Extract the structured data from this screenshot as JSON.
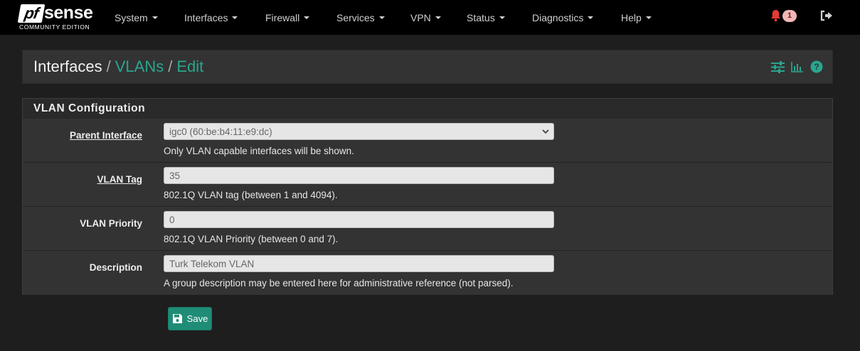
{
  "brand": {
    "logo_pf": "pf",
    "logo_sense": "sense",
    "edition": "COMMUNITY EDITION"
  },
  "nav": {
    "items": [
      {
        "label": "System"
      },
      {
        "label": "Interfaces"
      },
      {
        "label": "Firewall"
      },
      {
        "label": "Services"
      },
      {
        "label": "VPN"
      },
      {
        "label": "Status"
      },
      {
        "label": "Diagnostics"
      },
      {
        "label": "Help"
      }
    ],
    "alert_count": "1",
    "icons": {
      "alert": "bell-icon",
      "logout": "sign-out-icon"
    }
  },
  "breadcrumb": {
    "root": "Interfaces",
    "sep1": "/",
    "level2": "VLANs",
    "sep2": "/",
    "level3": "Edit",
    "icons": [
      "sliders-icon",
      "bar-chart-icon",
      "help-icon"
    ]
  },
  "panel": {
    "title": "VLAN Configuration",
    "rows": [
      {
        "label": "Parent Interface",
        "value": "igc0 (60:be:b4:11:e9:dc)",
        "help": "Only VLAN capable interfaces will be shown.",
        "type": "select"
      },
      {
        "label": "VLAN Tag",
        "value": "35",
        "help": "802.1Q VLAN tag (between 1 and 4094).",
        "type": "input"
      },
      {
        "label": "VLAN Priority",
        "value": "0",
        "help": "802.1Q VLAN Priority (between 0 and 7).",
        "type": "input"
      },
      {
        "label": "Description",
        "value": "Turk Telekom VLAN",
        "help": "A group description may be entered here for administrative reference (not parsed).",
        "type": "input"
      }
    ]
  },
  "save_button": {
    "label": "Save",
    "icon": "save-icon"
  },
  "colors": {
    "accent": "#2aa58f",
    "button": "#1f8c77",
    "navbar": "#000000",
    "background": "#1e1e1e",
    "alert": "#e53935"
  }
}
